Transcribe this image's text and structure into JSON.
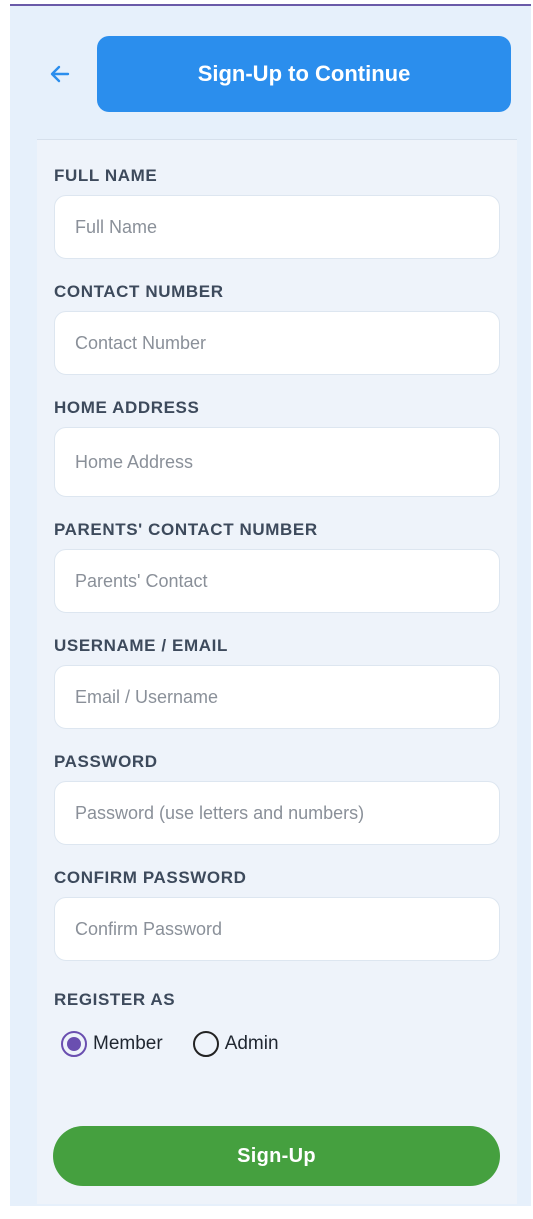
{
  "header": {
    "title": "Sign-Up to Continue",
    "back_icon": "arrow-left-icon"
  },
  "form": {
    "full_name": {
      "label": "FULL NAME",
      "placeholder": "Full Name",
      "value": ""
    },
    "contact_number": {
      "label": "CONTACT NUMBER",
      "placeholder": "Contact Number",
      "value": ""
    },
    "home_address": {
      "label": "HOME ADDRESS",
      "placeholder": "Home Address",
      "value": ""
    },
    "parents_contact": {
      "label": "PARENTS' CONTACT NUMBER",
      "placeholder": "Parents' Contact",
      "value": ""
    },
    "username_email": {
      "label": "USERNAME / EMAIL",
      "placeholder": "Email / Username",
      "value": ""
    },
    "password": {
      "label": "PASSWORD",
      "placeholder": "Password (use letters and numbers)",
      "value": ""
    },
    "confirm_password": {
      "label": "CONFIRM PASSWORD",
      "placeholder": "Confirm Password",
      "value": ""
    },
    "register_as": {
      "label": "REGISTER AS",
      "options": [
        "Member",
        "Admin"
      ],
      "selected": "Member"
    },
    "submit_label": "Sign-Up"
  },
  "colors": {
    "title_bar": "#2b8eed",
    "submit_button": "#45a03f",
    "radio_selected": "#6a4fb0",
    "background": "#e6f0fb"
  }
}
